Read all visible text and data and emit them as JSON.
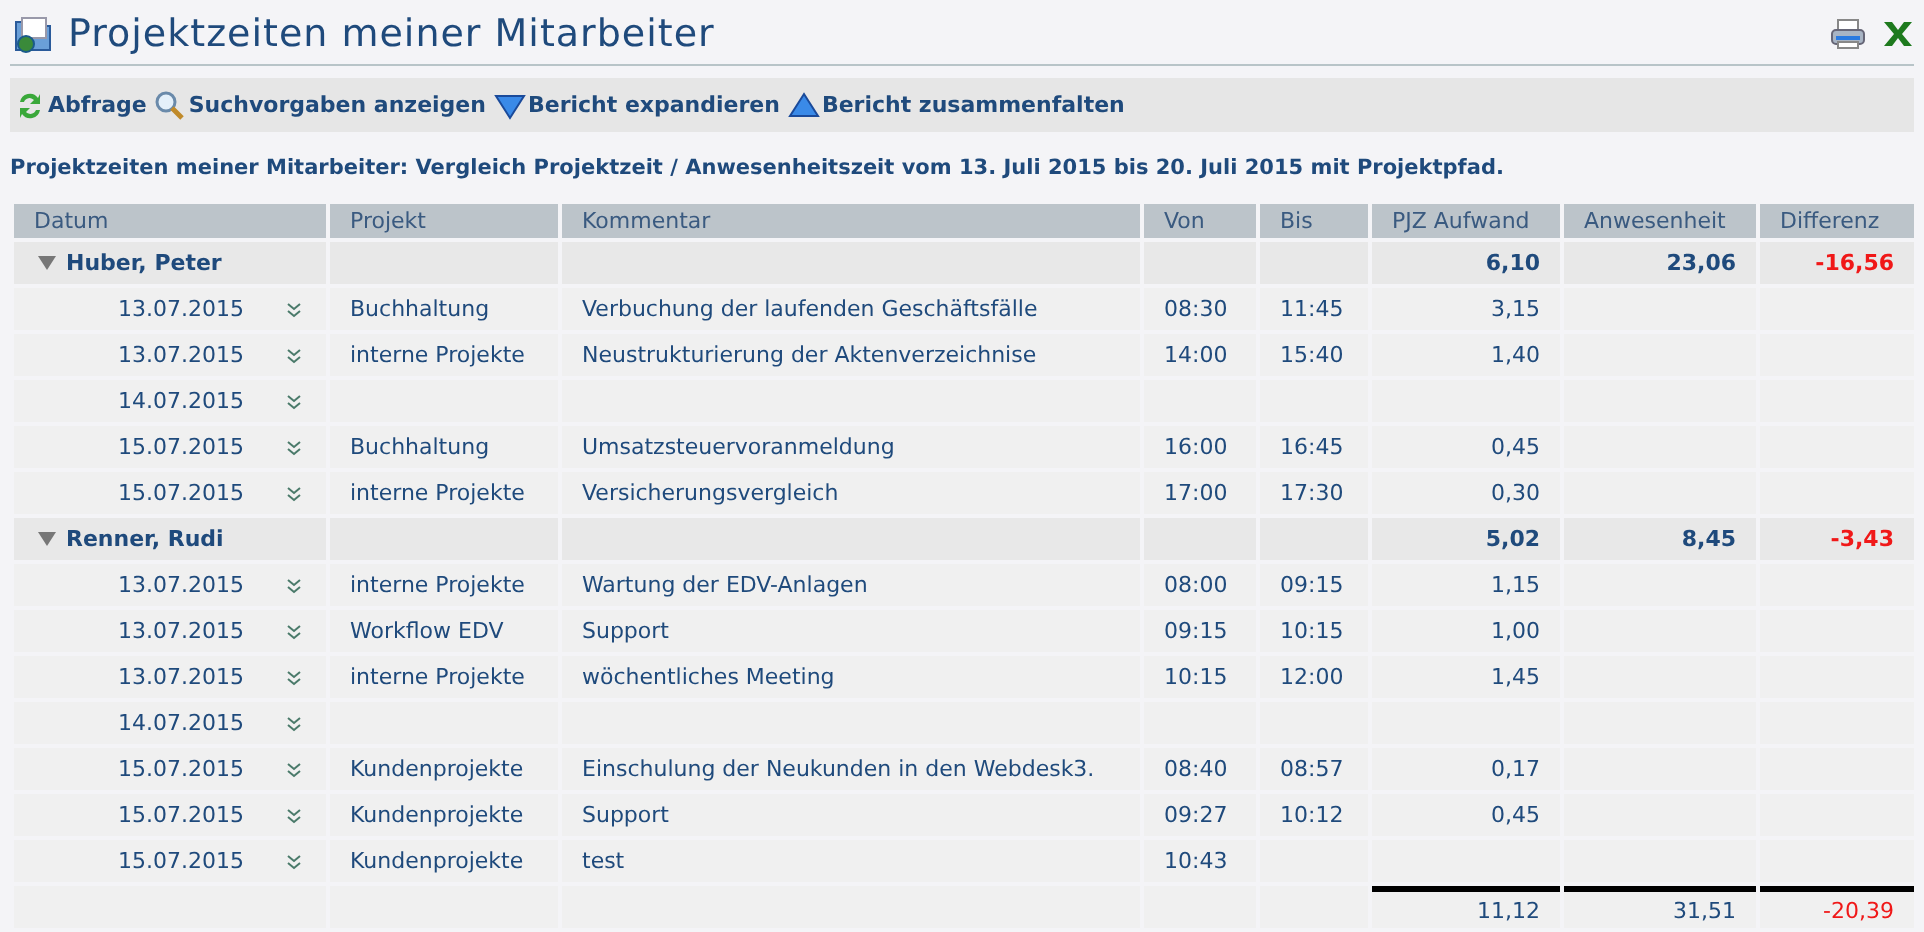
{
  "page": {
    "title": "Projektzeiten meiner Mitarbeiter"
  },
  "toolbar": [
    {
      "kind": "refresh",
      "label": "Abfrage"
    },
    {
      "kind": "search",
      "label": "Suchvorgaben anzeigen"
    },
    {
      "kind": "expand",
      "label": "Bericht expandieren"
    },
    {
      "kind": "collapse",
      "label": "Bericht zusammenfalten"
    }
  ],
  "caption": "Projektzeiten meiner Mitarbeiter: Vergleich Projektzeit / Anwesenheitszeit vom 13. Juli 2015 bis 20. Juli 2015 mit Projektpfad.",
  "table": {
    "columns": [
      "Datum",
      "Projekt",
      "Kommentar",
      "Von",
      "Bis",
      "PJZ Aufwand",
      "Anwesenheit",
      "Differenz"
    ],
    "groups": [
      {
        "name": "Huber, Peter",
        "expanded": true,
        "aufwand": "6,10",
        "anwesenheit": "23,06",
        "differenz": "-16,56",
        "rows": [
          {
            "datum": "13.07.2015",
            "projekt": "Buchhaltung",
            "kommentar": "Verbuchung der laufenden Geschäftsfälle",
            "von": "08:30",
            "bis": "11:45",
            "aufwand": "3,15"
          },
          {
            "datum": "13.07.2015",
            "projekt": "interne Projekte",
            "kommentar": "Neustrukturierung der Aktenverzeichnise",
            "von": "14:00",
            "bis": "15:40",
            "aufwand": "1,40"
          },
          {
            "datum": "14.07.2015"
          },
          {
            "datum": "15.07.2015",
            "projekt": "Buchhaltung",
            "kommentar": "Umsatzsteuervoranmeldung",
            "von": "16:00",
            "bis": "16:45",
            "aufwand": "0,45"
          },
          {
            "datum": "15.07.2015",
            "projekt": "interne Projekte",
            "kommentar": "Versicherungsvergleich",
            "von": "17:00",
            "bis": "17:30",
            "aufwand": "0,30"
          }
        ]
      },
      {
        "name": "Renner, Rudi",
        "expanded": true,
        "aufwand": "5,02",
        "anwesenheit": "8,45",
        "differenz": "-3,43",
        "rows": [
          {
            "datum": "13.07.2015",
            "projekt": "interne Projekte",
            "kommentar": "Wartung der EDV-Anlagen",
            "von": "08:00",
            "bis": "09:15",
            "aufwand": "1,15"
          },
          {
            "datum": "13.07.2015",
            "projekt": "Workflow EDV",
            "kommentar": "Support",
            "von": "09:15",
            "bis": "10:15",
            "aufwand": "1,00"
          },
          {
            "datum": "13.07.2015",
            "projekt": "interne Projekte",
            "kommentar": "wöchentliches Meeting",
            "von": "10:15",
            "bis": "12:00",
            "aufwand": "1,45"
          },
          {
            "datum": "14.07.2015"
          },
          {
            "datum": "15.07.2015",
            "projekt": "Kundenprojekte",
            "kommentar": "Einschulung der Neukunden in den Webdesk3.",
            "von": "08:40",
            "bis": "08:57",
            "aufwand": "0,17"
          },
          {
            "datum": "15.07.2015",
            "projekt": "Kundenprojekte",
            "kommentar": "Support",
            "von": "09:27",
            "bis": "10:12",
            "aufwand": "0,45"
          },
          {
            "datum": "15.07.2015",
            "projekt": "Kundenprojekte",
            "kommentar": "test",
            "von": "10:43"
          }
        ]
      }
    ],
    "totals": {
      "aufwand": "11,12",
      "anwesenheit": "31,51",
      "differenz": "-20,39"
    }
  }
}
